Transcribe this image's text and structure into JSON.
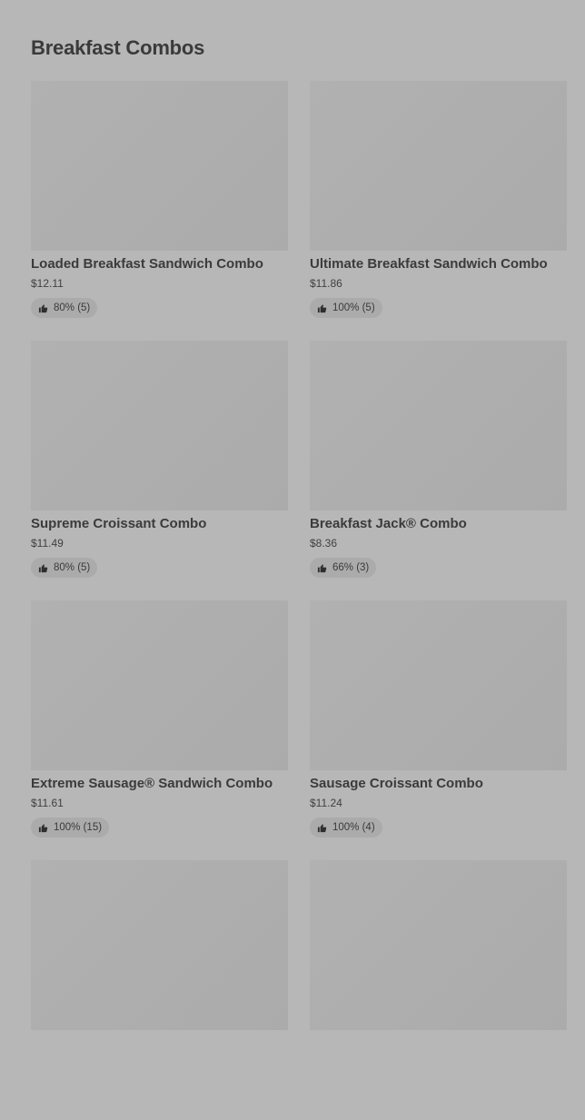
{
  "section": {
    "title": "Breakfast Combos"
  },
  "items": [
    {
      "name": "Loaded Breakfast Sandwich Combo",
      "price": "$12.11",
      "rating": "80% (5)"
    },
    {
      "name": "Ultimate Breakfast Sandwich Combo",
      "price": "$11.86",
      "rating": "100% (5)"
    },
    {
      "name": "Supreme Croissant Combo",
      "price": "$11.49",
      "rating": "80% (5)"
    },
    {
      "name": "Breakfast Jack® Combo",
      "price": "$8.36",
      "rating": "66% (3)"
    },
    {
      "name": "Extreme Sausage® Sandwich Combo",
      "price": "$11.61",
      "rating": "100% (15)"
    },
    {
      "name": "Sausage Croissant Combo",
      "price": "$11.24",
      "rating": "100% (4)"
    },
    {
      "name": "",
      "price": "",
      "rating": ""
    },
    {
      "name": "",
      "price": "",
      "rating": ""
    }
  ],
  "icons": {
    "rating_icon": "thumbs-up-icon"
  },
  "colors": {
    "background": "#b7b7b7",
    "placeholder": "#adadad",
    "text": "#3a3a3a"
  }
}
